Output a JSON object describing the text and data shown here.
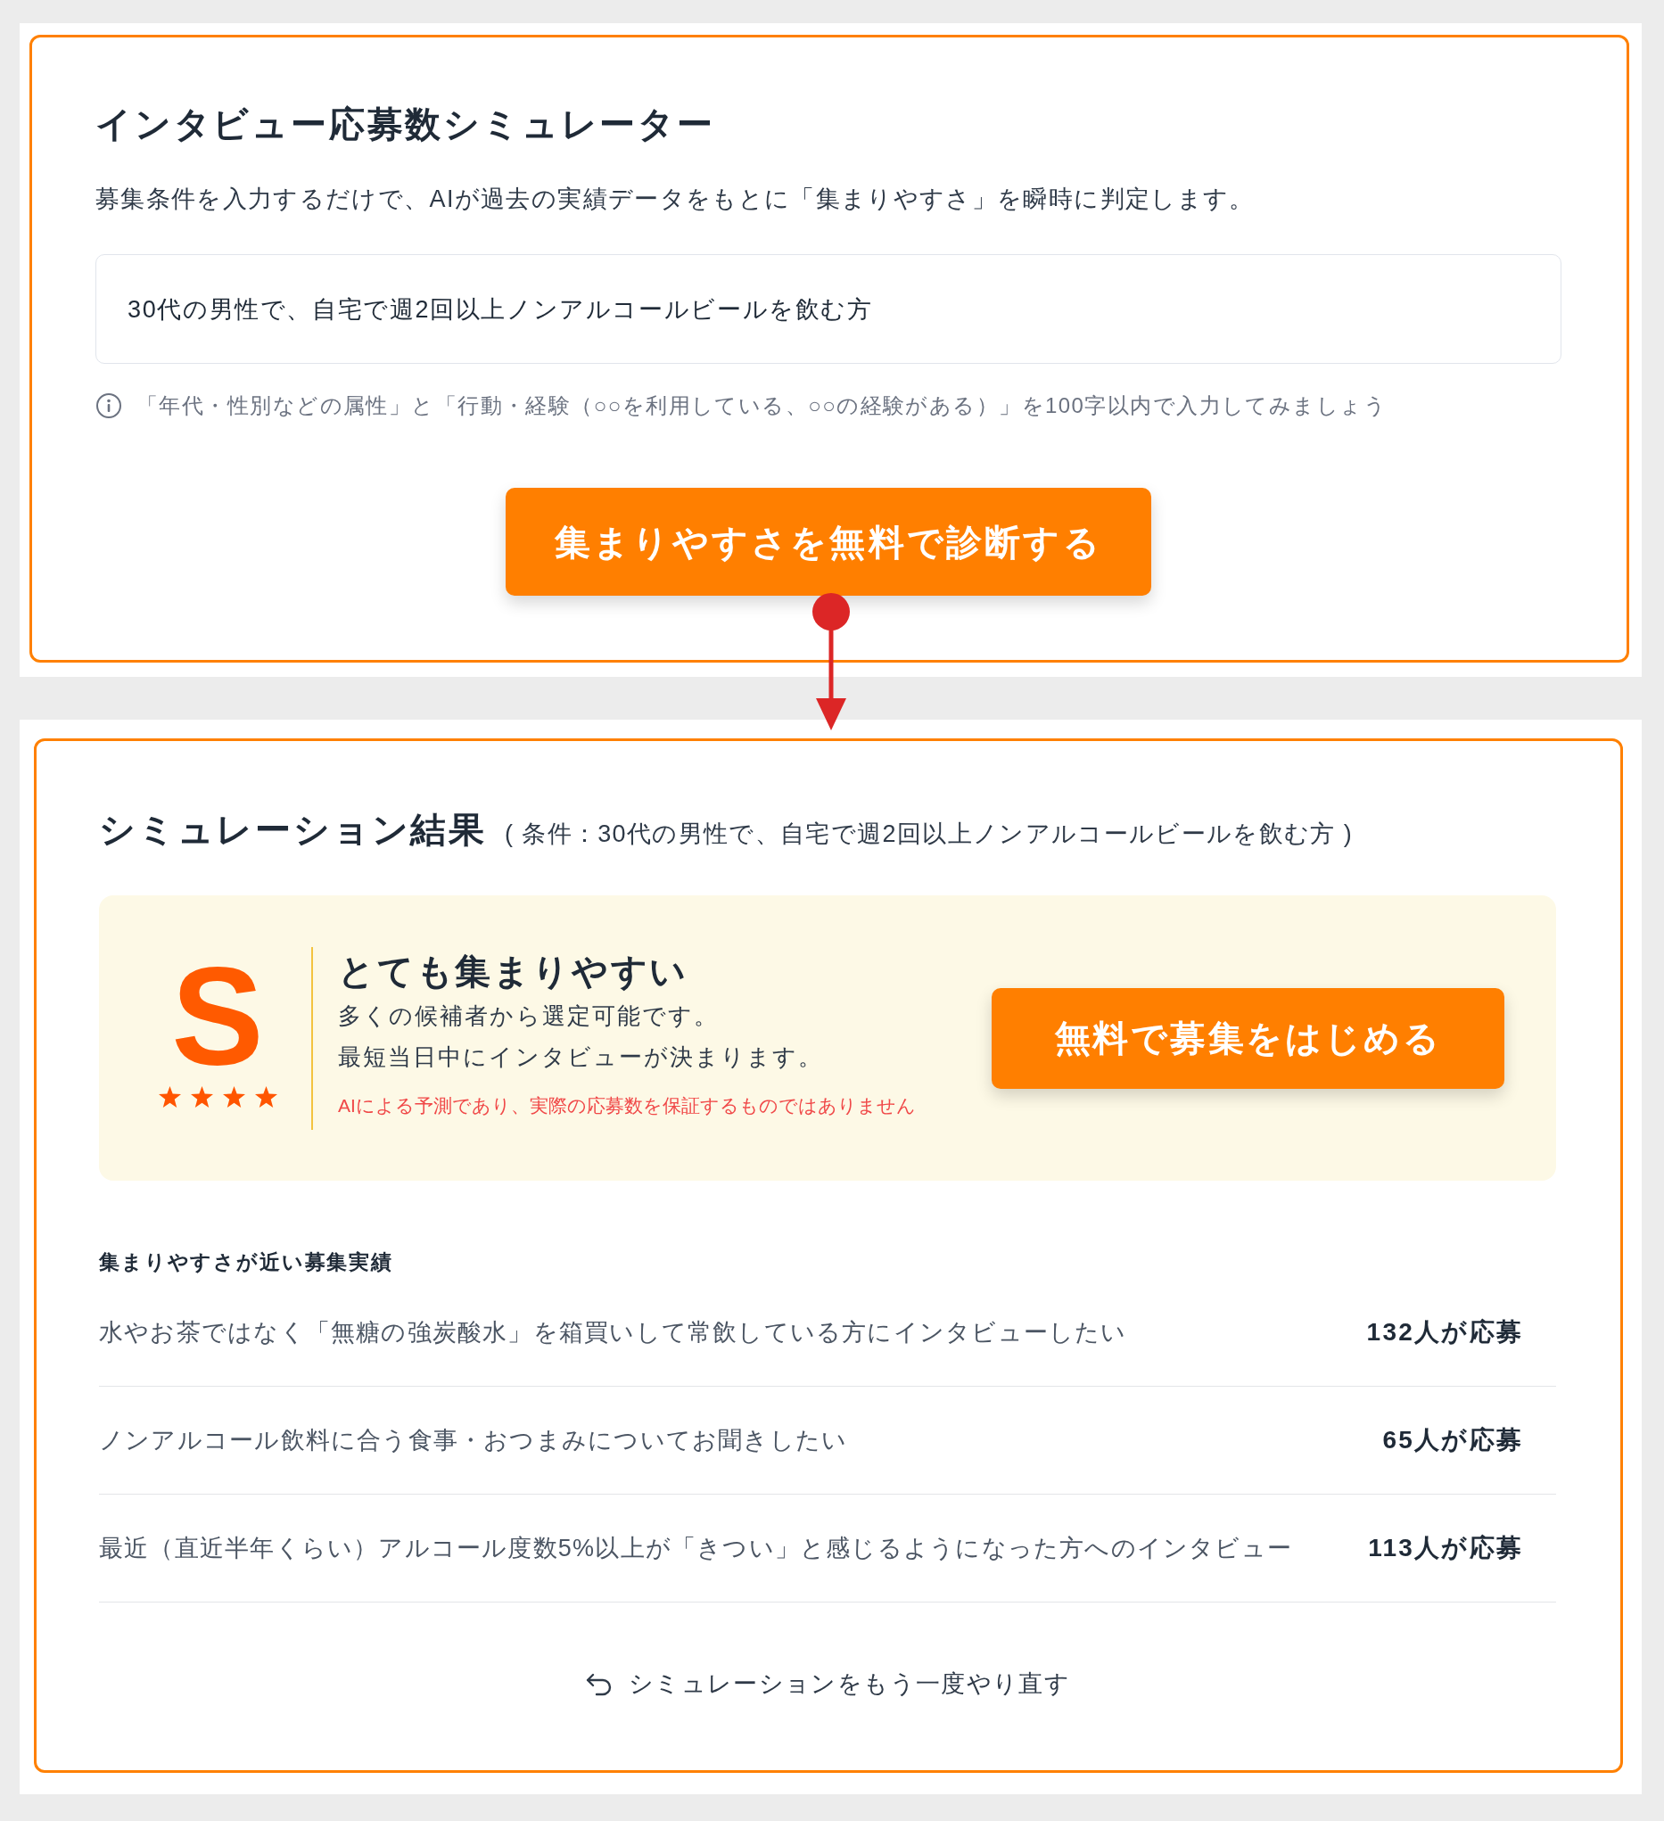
{
  "simulator": {
    "title": "インタビュー応募数シミュレーター",
    "description": "募集条件を入力するだけで、AIが過去の実績データをもとに「集まりやすさ」を瞬時に判定します。",
    "condition_field": {
      "value": "30代の男性で、自宅で週2回以上ノンアルコールビールを飲む方"
    },
    "hint": "「年代・性別などの属性」と「行動・経験（○○を利用している、○○の経験がある）」を100字以内で入力してみましょう",
    "submit_button": "集まりやすさを無料で診断する"
  },
  "result": {
    "title": "シミュレーション結果",
    "condition": "( 条件：30代の男性で、自宅で週2回以上ノンアルコールビールを飲む方 )",
    "rating": {
      "grade": "S",
      "stars": 4,
      "headline": "とても集まりやすい",
      "lines": [
        "多くの候補者から選定可能です。",
        "最短当日中にインタビューが決まります。"
      ],
      "disclaimer": "AIによる予測であり、実際の応募数を保証するものではありません"
    },
    "cta_button": "無料で募集をはじめる",
    "similar": {
      "heading": "集まりやすさが近い募集実績",
      "rows": [
        {
          "title": "水やお茶ではなく「無糖の強炭酸水」を箱買いして常飲している方にインタビューしたい",
          "applicants": "132人が応募"
        },
        {
          "title": "ノンアルコール飲料に合う食事・おつまみについてお聞きしたい",
          "applicants": "65人が応募"
        },
        {
          "title": "最近（直近半年くらい）アルコール度数5%以上が「きつい」と感じるようになった方へのインタビュー",
          "applicants": "113人が応募"
        }
      ]
    },
    "retry_link": "シミュレーションをもう一度やり直す"
  }
}
